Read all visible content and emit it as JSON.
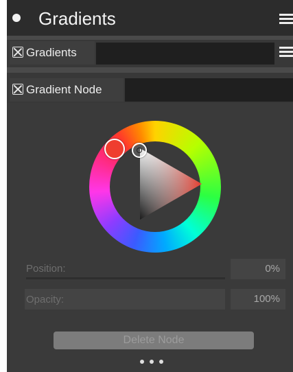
{
  "panel": {
    "title": "Gradients"
  },
  "tabs": [
    {
      "label": "Gradients"
    },
    {
      "label": "Gradient Node"
    }
  ],
  "color_picker": {
    "selected_hue_color": "#ef3d2f"
  },
  "properties": {
    "position": {
      "label": "Position:",
      "value": "0%"
    },
    "opacity": {
      "label": "Opacity:",
      "value": "100%"
    }
  },
  "actions": {
    "delete_label": "Delete Node"
  }
}
